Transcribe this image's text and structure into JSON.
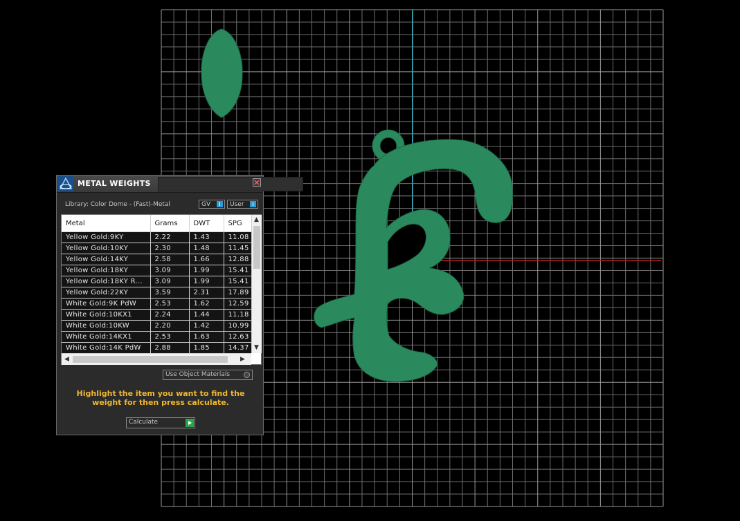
{
  "colors": {
    "background": "#000000",
    "grid": "#6e6e6e",
    "model": "#2a8a5e",
    "axis_y": "#2aa7b8",
    "axis_x": "#b42020",
    "hint_text": "#f0b82c",
    "accent_blue": "#2e9bd6",
    "accent_green": "#2aa64a"
  },
  "panel": {
    "title": "METAL WEIGHTS",
    "icon": "app-logo-icon",
    "library_label": "Library: Color Dome - (Fast)-Metal",
    "gv_label": "GV",
    "user_label": "User",
    "columns": [
      "Metal",
      "Grams",
      "DWT",
      "SPG"
    ],
    "rows": [
      [
        "Yellow Gold:9KY",
        "2.22",
        "1.43",
        "11.08"
      ],
      [
        "Yellow Gold:10KY",
        "2.30",
        "1.48",
        "11.45"
      ],
      [
        "Yellow Gold:14KY",
        "2.58",
        "1.66",
        "12.88"
      ],
      [
        "Yellow Gold:18KY",
        "3.09",
        "1.99",
        "15.41"
      ],
      [
        "Yellow Gold:18KY R...",
        "3.09",
        "1.99",
        "15.41"
      ],
      [
        "Yellow Gold:22KY",
        "3.59",
        "2.31",
        "17.89"
      ],
      [
        "White Gold:9K PdW",
        "2.53",
        "1.62",
        "12.59"
      ],
      [
        "White Gold:10KX1",
        "2.24",
        "1.44",
        "11.18"
      ],
      [
        "White Gold:10KW",
        "2.20",
        "1.42",
        "10.99"
      ],
      [
        "White Gold:14KX1",
        "2.53",
        "1.63",
        "12.63"
      ],
      [
        "White Gold:14K PdW",
        "2.88",
        "1.85",
        "14.37"
      ]
    ],
    "use_object_materials": "Use Object Materials",
    "hint": "Highlight the item you want to find the weight for then press calculate.",
    "calculate_label": "Calculate"
  }
}
